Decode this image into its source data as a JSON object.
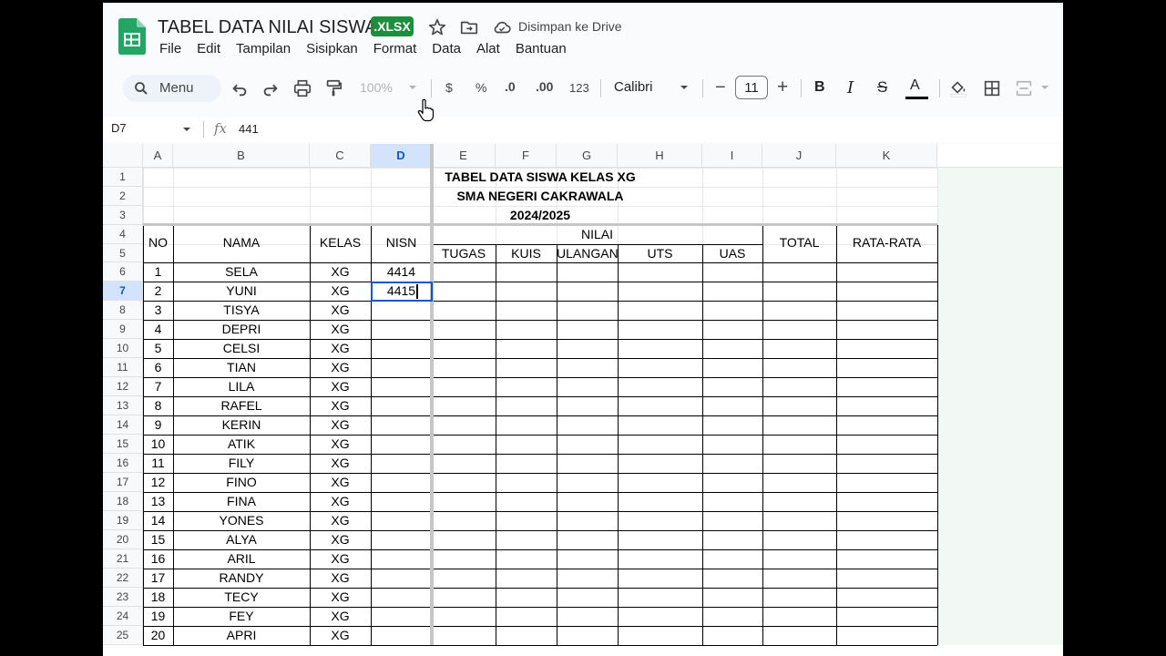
{
  "app": {
    "title": "TABEL DATA NILAI SISWA",
    "file_badge": ".XLSX",
    "save_status": "Disimpan ke Drive",
    "brand_color": "#1e8e3e"
  },
  "menu": [
    "File",
    "Edit",
    "Tampilan",
    "Sisipkan",
    "Format",
    "Data",
    "Alat",
    "Bantuan"
  ],
  "toolbar": {
    "search_label": "Menu",
    "zoom": "100%",
    "currency": "$",
    "percent": "%",
    "dec_decrease": ".0",
    "dec_increase": ".00",
    "number_format": "123",
    "font": "Calibri",
    "font_size": "11",
    "minus": "−",
    "plus": "+",
    "bold": "B",
    "italic": "I",
    "strike": "S",
    "text_color": "A"
  },
  "formula_bar": {
    "name_box": "D7",
    "fx": "fx",
    "value": "441"
  },
  "columns": [
    "A",
    "B",
    "C",
    "D",
    "E",
    "F",
    "G",
    "H",
    "I",
    "J",
    "K"
  ],
  "rows": [
    "1",
    "2",
    "3",
    "4",
    "5",
    "6",
    "7",
    "8",
    "9",
    "10",
    "11",
    "12",
    "13",
    "14",
    "15",
    "16",
    "17",
    "18",
    "19",
    "20",
    "21",
    "22",
    "23",
    "24",
    "25"
  ],
  "sheet": {
    "title_lines": [
      "TABEL DATA SISWA KELAS XG",
      "SMA NEGERI CAKRAWALA",
      "2024/2025"
    ],
    "headers": {
      "no": "NO",
      "nama": "NAMA",
      "kelas": "KELAS",
      "nisn": "NISN",
      "nilai": "NILAI",
      "tugas": "TUGAS",
      "kuis": "KUIS",
      "ulangan": "ULANGAN",
      "uts": "UTS",
      "uas": "UAS",
      "total": "TOTAL",
      "rata": "RATA-RATA"
    },
    "students": [
      {
        "no": "1",
        "nama": "SELA",
        "kelas": "XG",
        "nisn": "4414"
      },
      {
        "no": "2",
        "nama": "YUNI",
        "kelas": "XG",
        "nisn": "4415"
      },
      {
        "no": "3",
        "nama": "TISYA",
        "kelas": "XG",
        "nisn": ""
      },
      {
        "no": "4",
        "nama": "DEPRI",
        "kelas": "XG",
        "nisn": ""
      },
      {
        "no": "5",
        "nama": "CELSI",
        "kelas": "XG",
        "nisn": ""
      },
      {
        "no": "6",
        "nama": "TIAN",
        "kelas": "XG",
        "nisn": ""
      },
      {
        "no": "7",
        "nama": "LILA",
        "kelas": "XG",
        "nisn": ""
      },
      {
        "no": "8",
        "nama": "RAFEL",
        "kelas": "XG",
        "nisn": ""
      },
      {
        "no": "9",
        "nama": "KERIN",
        "kelas": "XG",
        "nisn": ""
      },
      {
        "no": "10",
        "nama": "ATIK",
        "kelas": "XG",
        "nisn": ""
      },
      {
        "no": "11",
        "nama": "FILY",
        "kelas": "XG",
        "nisn": ""
      },
      {
        "no": "12",
        "nama": "FINO",
        "kelas": "XG",
        "nisn": ""
      },
      {
        "no": "13",
        "nama": "FINA",
        "kelas": "XG",
        "nisn": ""
      },
      {
        "no": "14",
        "nama": "YONES",
        "kelas": "XG",
        "nisn": ""
      },
      {
        "no": "15",
        "nama": "ALYA",
        "kelas": "XG",
        "nisn": ""
      },
      {
        "no": "16",
        "nama": "ARIL",
        "kelas": "XG",
        "nisn": ""
      },
      {
        "no": "17",
        "nama": "RANDY",
        "kelas": "XG",
        "nisn": ""
      },
      {
        "no": "18",
        "nama": "TECY",
        "kelas": "XG",
        "nisn": ""
      },
      {
        "no": "19",
        "nama": "FEY",
        "kelas": "XG",
        "nisn": ""
      },
      {
        "no": "20",
        "nama": "APRI",
        "kelas": "XG",
        "nisn": ""
      }
    ]
  }
}
